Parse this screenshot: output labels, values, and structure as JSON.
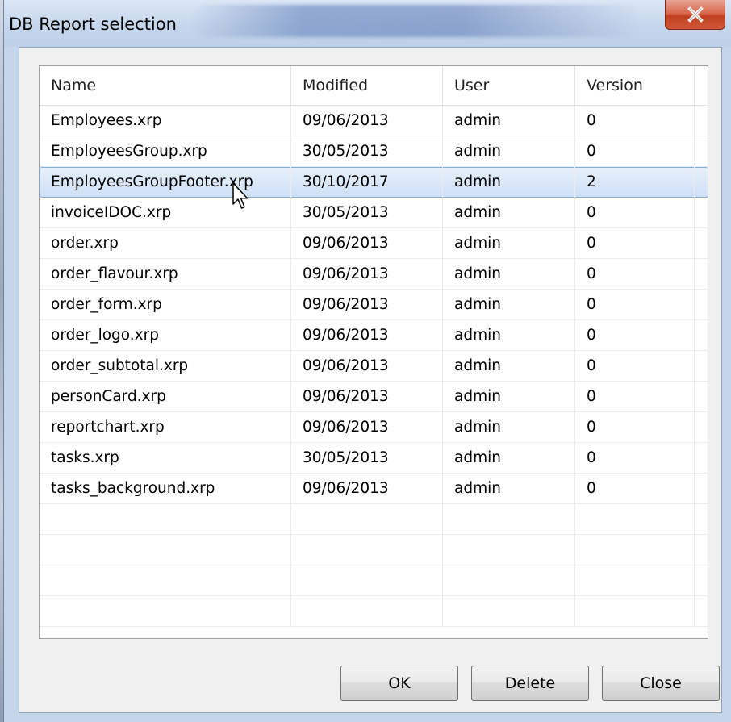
{
  "window": {
    "title": "DB Report selection",
    "close_icon": "close-x-icon"
  },
  "table": {
    "columns": [
      "Name",
      "Modified",
      "User",
      "Version"
    ],
    "rows": [
      {
        "name": "Employees.xrp",
        "modified": "09/06/2013",
        "user": "admin",
        "version": "0"
      },
      {
        "name": "EmployeesGroup.xrp",
        "modified": "30/05/2013",
        "user": "admin",
        "version": "0"
      },
      {
        "name": "EmployeesGroupFooter.xrp",
        "modified": "30/10/2017",
        "user": "admin",
        "version": "2"
      },
      {
        "name": "invoiceIDOC.xrp",
        "modified": "30/05/2013",
        "user": "admin",
        "version": "0"
      },
      {
        "name": "order.xrp",
        "modified": "09/06/2013",
        "user": "admin",
        "version": "0"
      },
      {
        "name": "order_flavour.xrp",
        "modified": "09/06/2013",
        "user": "admin",
        "version": "0"
      },
      {
        "name": "order_form.xrp",
        "modified": "09/06/2013",
        "user": "admin",
        "version": "0"
      },
      {
        "name": "order_logo.xrp",
        "modified": "09/06/2013",
        "user": "admin",
        "version": "0"
      },
      {
        "name": "order_subtotal.xrp",
        "modified": "09/06/2013",
        "user": "admin",
        "version": "0"
      },
      {
        "name": "personCard.xrp",
        "modified": "09/06/2013",
        "user": "admin",
        "version": "0"
      },
      {
        "name": "reportchart.xrp",
        "modified": "09/06/2013",
        "user": "admin",
        "version": "0"
      },
      {
        "name": "tasks.xrp",
        "modified": "30/05/2013",
        "user": "admin",
        "version": "0"
      },
      {
        "name": "tasks_background.xrp",
        "modified": "09/06/2013",
        "user": "admin",
        "version": "0"
      }
    ],
    "selected_row_index": 2
  },
  "buttons": {
    "ok": "OK",
    "delete": "Delete",
    "close": "Close"
  },
  "colors": {
    "selection_border": "#84acdd",
    "selection_fill": "#dce8f7",
    "close_button": "#c9452a",
    "window_frame": "#c4d5ea"
  }
}
